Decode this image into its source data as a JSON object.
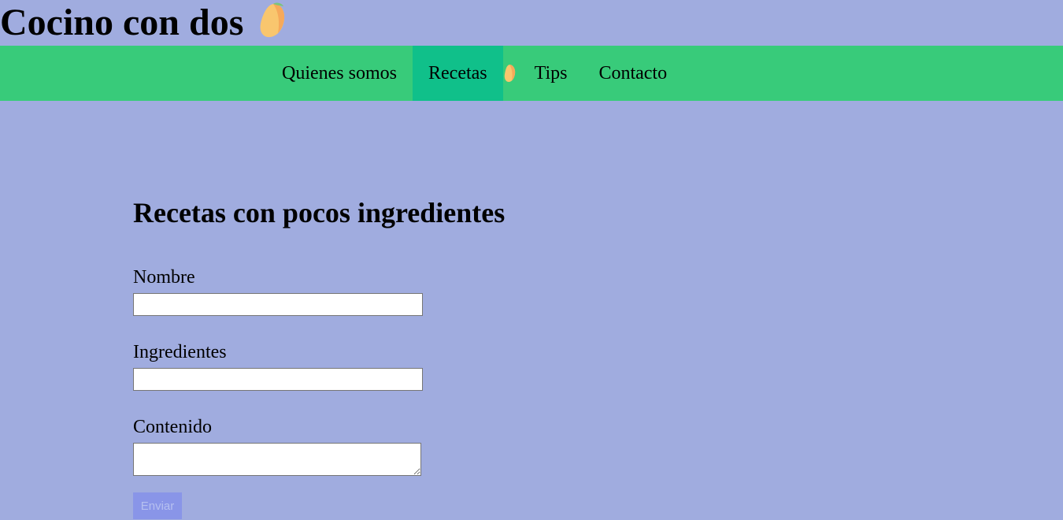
{
  "header": {
    "title": "Cocino con dos",
    "logo_icon": "mango-icon"
  },
  "nav": {
    "items": [
      {
        "label": "Quienes somos",
        "active": false
      },
      {
        "label": "Recetas",
        "active": true
      },
      {
        "label": "Tips",
        "active": false
      },
      {
        "label": "Contacto",
        "active": false
      }
    ]
  },
  "main": {
    "title": "Recetas con pocos ingredientes",
    "form": {
      "nombre_label": "Nombre",
      "nombre_value": "",
      "ingredientes_label": "Ingredientes",
      "ingredientes_value": "",
      "contenido_label": "Contenido",
      "contenido_value": "",
      "submit_label": "Enviar"
    }
  },
  "colors": {
    "background": "#a0acdf",
    "nav_background": "#38cb7a",
    "nav_active": "#10c08a",
    "button": "#8995e8"
  }
}
